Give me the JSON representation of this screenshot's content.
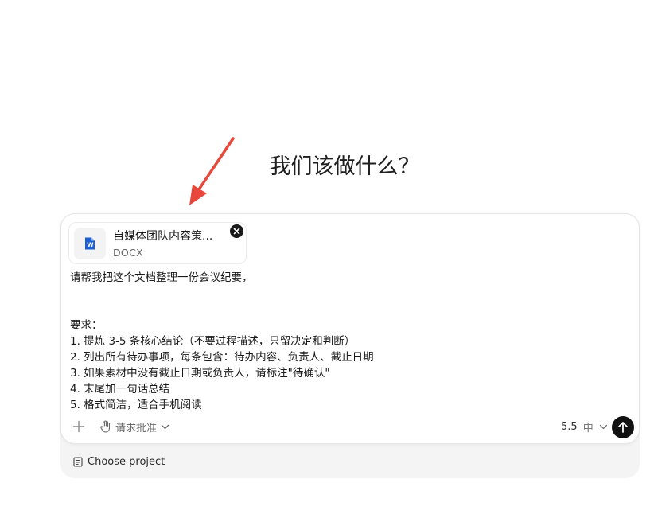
{
  "heading": "我们该做什么？",
  "attachment": {
    "name": "自媒体团队内容策...",
    "type": "DOCX",
    "icon": "word-document-icon",
    "icon_color": "#1a5fd6"
  },
  "message": {
    "lines": [
      "请帮我把这个文档整理一份会议纪要，",
      "",
      "",
      "要求：",
      "1. 提炼 3-5 条核心结论（不要过程描述，只留决定和判断）",
      "2. 列出所有待办事项，每条包含：待办内容、负责人、截止日期",
      "3. 如果素材中没有截止日期或负责人，请标注\"待确认\"",
      "4. 末尾加一句话总结",
      "5. 格式简洁，适合手机阅读"
    ]
  },
  "toolbar": {
    "add_icon": "plus-icon",
    "approval_label": "请求批准",
    "approval_icon": "hand-icon",
    "model_version": "5.5",
    "model_level": "中",
    "send_icon": "arrow-up-icon"
  },
  "project": {
    "label": "Choose project",
    "icon": "document-icon"
  },
  "colors": {
    "arrow": "#e8473b",
    "send_button": "#111111",
    "outer_card": "#f4f4f4"
  }
}
